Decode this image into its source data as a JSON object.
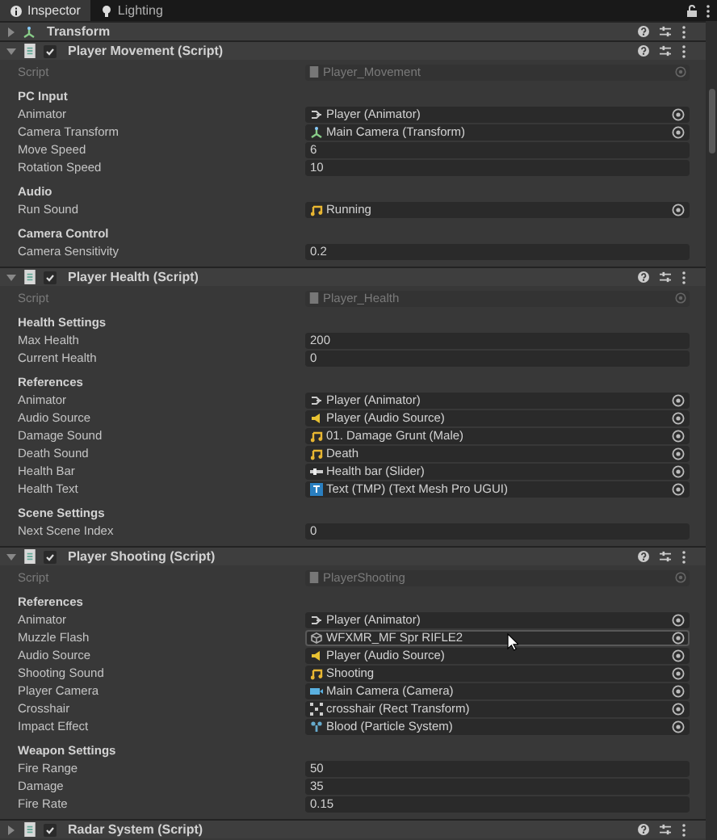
{
  "tabs": [
    {
      "label": "Inspector",
      "selected": true
    },
    {
      "label": "Lighting",
      "selected": false
    }
  ],
  "components": [
    {
      "title": "Transform",
      "kind": "transform",
      "expanded": false
    },
    {
      "title": "Player Movement (Script)",
      "kind": "script",
      "expanded": true,
      "enabled": true,
      "script": "Player_Movement",
      "script_label": "Script",
      "sections": [
        {
          "title": "PC Input",
          "fields": [
            {
              "label": "Animator",
              "kind": "animator",
              "value": "Player (Animator)"
            },
            {
              "label": "Camera Transform",
              "kind": "transform",
              "value": "Main Camera (Transform)"
            },
            {
              "label": "Move Speed",
              "kind": "number",
              "value": "6"
            },
            {
              "label": "Rotation Speed",
              "kind": "number",
              "value": "10"
            }
          ]
        },
        {
          "title": "Audio",
          "fields": [
            {
              "label": "Run Sound",
              "kind": "clip",
              "value": "Running"
            }
          ]
        },
        {
          "title": "Camera Control",
          "fields": [
            {
              "label": "Camera Sensitivity",
              "kind": "number",
              "value": "0.2"
            }
          ]
        }
      ]
    },
    {
      "title": "Player Health (Script)",
      "kind": "script",
      "expanded": true,
      "enabled": true,
      "script": "Player_Health",
      "script_label": "Script",
      "sections": [
        {
          "title": "Health Settings",
          "fields": [
            {
              "label": "Max Health",
              "kind": "number",
              "value": "200"
            },
            {
              "label": "Current Health",
              "kind": "number",
              "value": "0"
            }
          ]
        },
        {
          "title": "References",
          "fields": [
            {
              "label": "Animator",
              "kind": "animator",
              "value": "Player (Animator)"
            },
            {
              "label": "Audio Source",
              "kind": "source",
              "value": "Player (Audio Source)"
            },
            {
              "label": "Damage Sound",
              "kind": "clip",
              "value": "01. Damage Grunt (Male)"
            },
            {
              "label": "Death Sound",
              "kind": "clip",
              "value": "Death"
            },
            {
              "label": "Health Bar",
              "kind": "slider",
              "value": "Health bar (Slider)"
            },
            {
              "label": "Health Text",
              "kind": "tmp",
              "value": "Text (TMP) (Text Mesh Pro UGUI)"
            }
          ]
        },
        {
          "title": "Scene Settings",
          "fields": [
            {
              "label": "Next Scene Index",
              "kind": "number",
              "value": "0"
            }
          ]
        }
      ]
    },
    {
      "title": "Player Shooting (Script)",
      "kind": "script",
      "expanded": true,
      "enabled": true,
      "script": "PlayerShooting",
      "script_label": "Script",
      "sections": [
        {
          "title": "References",
          "fields": [
            {
              "label": "Animator",
              "kind": "animator",
              "value": "Player (Animator)"
            },
            {
              "label": "Muzzle Flash",
              "kind": "prefab",
              "value": "WFXMR_MF Spr RIFLE2",
              "hovered": true
            },
            {
              "label": "Audio Source",
              "kind": "source",
              "value": "Player (Audio Source)"
            },
            {
              "label": "Shooting Sound",
              "kind": "clip",
              "value": "Shooting"
            },
            {
              "label": "Player Camera",
              "kind": "camera",
              "value": "Main Camera (Camera)"
            },
            {
              "label": "Crosshair",
              "kind": "rect",
              "value": "crosshair (Rect Transform)"
            },
            {
              "label": "Impact Effect",
              "kind": "particle",
              "value": "Blood (Particle System)"
            }
          ]
        },
        {
          "title": "Weapon Settings",
          "fields": [
            {
              "label": "Fire Range",
              "kind": "number",
              "value": "50"
            },
            {
              "label": "Damage",
              "kind": "number",
              "value": "35"
            },
            {
              "label": "Fire Rate",
              "kind": "number",
              "value": "0.15"
            }
          ]
        }
      ]
    },
    {
      "title": "Radar System (Script)",
      "kind": "script",
      "expanded": false,
      "enabled": true
    }
  ]
}
